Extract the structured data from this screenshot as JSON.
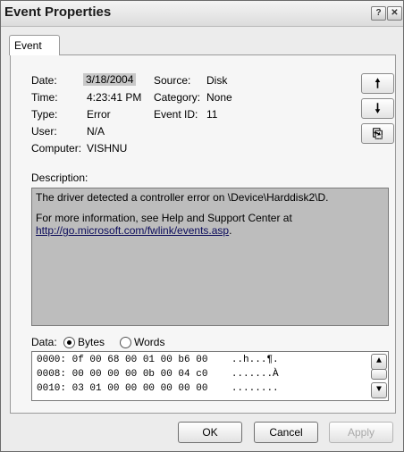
{
  "window": {
    "title": "Event Properties",
    "help_glyph": "?",
    "close_glyph": "✕"
  },
  "tabs": [
    {
      "label": "Event"
    }
  ],
  "fields": {
    "date_label": "Date:",
    "date_value": "3/18/2004",
    "time_label": "Time:",
    "time_value": "4:23:41 PM",
    "type_label": "Type:",
    "type_value": "Error",
    "user_label": "User:",
    "user_value": "N/A",
    "computer_label": "Computer:",
    "computer_value": "VISHNU",
    "source_label": "Source:",
    "source_value": "Disk",
    "category_label": "Category:",
    "category_value": "None",
    "event_id_label": "Event ID:",
    "event_id_value": "11"
  },
  "side_buttons": {
    "up_glyph": "🠕",
    "down_glyph": "🠗",
    "copy_glyph": "⎘"
  },
  "description": {
    "label": "Description:",
    "line1": "The driver detected a controller error on \\Device\\Harddisk2\\D.",
    "line2": "For more information, see Help and Support Center at",
    "link": "http://go.microsoft.com/fwlink/events.asp",
    "link_suffix": "."
  },
  "data_section": {
    "label": "Data:",
    "bytes_label": "Bytes",
    "words_label": "Words",
    "selected": "Bytes",
    "rows": [
      "0000: 0f 00 68 00 01 00 b6 00    ..h...¶.",
      "0008: 00 00 00 00 0b 00 04 c0    .......À",
      "0010: 03 01 00 00 00 00 00 00    ........"
    ]
  },
  "buttons": {
    "ok": "OK",
    "cancel": "Cancel",
    "apply": "Apply"
  }
}
